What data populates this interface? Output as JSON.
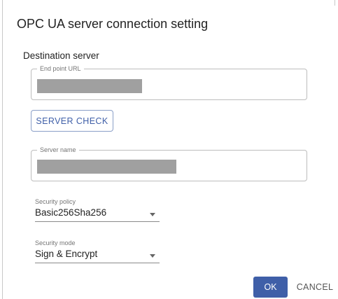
{
  "dialog": {
    "title": "OPC UA server connection setting",
    "section_label": "Destination server",
    "endpoint_url": {
      "label": "End point URL",
      "value": ""
    },
    "server_check_label": "SERVER CHECK",
    "server_name": {
      "label": "Server name",
      "value": ""
    },
    "security_policy": {
      "label": "Security policy",
      "value": "Basic256Sha256"
    },
    "security_mode": {
      "label": "Security mode",
      "value": "Sign & Encrypt"
    },
    "ok_label": "OK",
    "cancel_label": "CANCEL"
  },
  "colors": {
    "primary": "#3f5fa8",
    "redaction": "#a0a0a0"
  }
}
